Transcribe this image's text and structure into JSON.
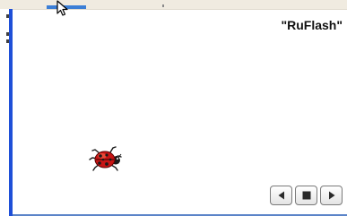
{
  "stage": {
    "title": "\"RuFlash\""
  },
  "sprite": {
    "icon": "ladybug-icon"
  },
  "player_controls": {
    "buttons": [
      {
        "name": "rewind-button",
        "icon": "triangle-left-icon"
      },
      {
        "name": "stop-button",
        "icon": "square-stop-icon"
      },
      {
        "name": "play-button",
        "icon": "triangle-right-icon"
      }
    ]
  },
  "colors": {
    "frame_blue": "#1e4fd8",
    "chrome_beige": "#f0ebe0",
    "ladybug_red": "#c81414"
  }
}
